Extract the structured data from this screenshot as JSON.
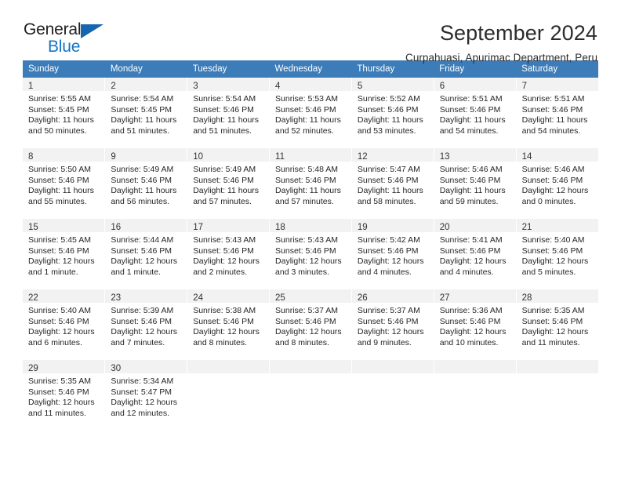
{
  "brand": {
    "name_top": "General",
    "name_bottom": "Blue",
    "triangle_color": "#1565b0",
    "blue_text_color": "#1275c4"
  },
  "header": {
    "title": "September 2024",
    "subtitle": "Curpahuasi, Apurimac Department, Peru"
  },
  "colors": {
    "header_row_bg": "#3c7cb8",
    "header_row_text": "#ffffff",
    "daynum_bg": "#f2f2f2",
    "cell_text": "#262626"
  },
  "weekday_headers": [
    "Sunday",
    "Monday",
    "Tuesday",
    "Wednesday",
    "Thursday",
    "Friday",
    "Saturday"
  ],
  "weeks": [
    [
      {
        "day": "1",
        "sunrise": "Sunrise: 5:55 AM",
        "sunset": "Sunset: 5:45 PM",
        "daylight1": "Daylight: 11 hours",
        "daylight2": "and 50 minutes."
      },
      {
        "day": "2",
        "sunrise": "Sunrise: 5:54 AM",
        "sunset": "Sunset: 5:45 PM",
        "daylight1": "Daylight: 11 hours",
        "daylight2": "and 51 minutes."
      },
      {
        "day": "3",
        "sunrise": "Sunrise: 5:54 AM",
        "sunset": "Sunset: 5:46 PM",
        "daylight1": "Daylight: 11 hours",
        "daylight2": "and 51 minutes."
      },
      {
        "day": "4",
        "sunrise": "Sunrise: 5:53 AM",
        "sunset": "Sunset: 5:46 PM",
        "daylight1": "Daylight: 11 hours",
        "daylight2": "and 52 minutes."
      },
      {
        "day": "5",
        "sunrise": "Sunrise: 5:52 AM",
        "sunset": "Sunset: 5:46 PM",
        "daylight1": "Daylight: 11 hours",
        "daylight2": "and 53 minutes."
      },
      {
        "day": "6",
        "sunrise": "Sunrise: 5:51 AM",
        "sunset": "Sunset: 5:46 PM",
        "daylight1": "Daylight: 11 hours",
        "daylight2": "and 54 minutes."
      },
      {
        "day": "7",
        "sunrise": "Sunrise: 5:51 AM",
        "sunset": "Sunset: 5:46 PM",
        "daylight1": "Daylight: 11 hours",
        "daylight2": "and 54 minutes."
      }
    ],
    [
      {
        "day": "8",
        "sunrise": "Sunrise: 5:50 AM",
        "sunset": "Sunset: 5:46 PM",
        "daylight1": "Daylight: 11 hours",
        "daylight2": "and 55 minutes."
      },
      {
        "day": "9",
        "sunrise": "Sunrise: 5:49 AM",
        "sunset": "Sunset: 5:46 PM",
        "daylight1": "Daylight: 11 hours",
        "daylight2": "and 56 minutes."
      },
      {
        "day": "10",
        "sunrise": "Sunrise: 5:49 AM",
        "sunset": "Sunset: 5:46 PM",
        "daylight1": "Daylight: 11 hours",
        "daylight2": "and 57 minutes."
      },
      {
        "day": "11",
        "sunrise": "Sunrise: 5:48 AM",
        "sunset": "Sunset: 5:46 PM",
        "daylight1": "Daylight: 11 hours",
        "daylight2": "and 57 minutes."
      },
      {
        "day": "12",
        "sunrise": "Sunrise: 5:47 AM",
        "sunset": "Sunset: 5:46 PM",
        "daylight1": "Daylight: 11 hours",
        "daylight2": "and 58 minutes."
      },
      {
        "day": "13",
        "sunrise": "Sunrise: 5:46 AM",
        "sunset": "Sunset: 5:46 PM",
        "daylight1": "Daylight: 11 hours",
        "daylight2": "and 59 minutes."
      },
      {
        "day": "14",
        "sunrise": "Sunrise: 5:46 AM",
        "sunset": "Sunset: 5:46 PM",
        "daylight1": "Daylight: 12 hours",
        "daylight2": "and 0 minutes."
      }
    ],
    [
      {
        "day": "15",
        "sunrise": "Sunrise: 5:45 AM",
        "sunset": "Sunset: 5:46 PM",
        "daylight1": "Daylight: 12 hours",
        "daylight2": "and 1 minute."
      },
      {
        "day": "16",
        "sunrise": "Sunrise: 5:44 AM",
        "sunset": "Sunset: 5:46 PM",
        "daylight1": "Daylight: 12 hours",
        "daylight2": "and 1 minute."
      },
      {
        "day": "17",
        "sunrise": "Sunrise: 5:43 AM",
        "sunset": "Sunset: 5:46 PM",
        "daylight1": "Daylight: 12 hours",
        "daylight2": "and 2 minutes."
      },
      {
        "day": "18",
        "sunrise": "Sunrise: 5:43 AM",
        "sunset": "Sunset: 5:46 PM",
        "daylight1": "Daylight: 12 hours",
        "daylight2": "and 3 minutes."
      },
      {
        "day": "19",
        "sunrise": "Sunrise: 5:42 AM",
        "sunset": "Sunset: 5:46 PM",
        "daylight1": "Daylight: 12 hours",
        "daylight2": "and 4 minutes."
      },
      {
        "day": "20",
        "sunrise": "Sunrise: 5:41 AM",
        "sunset": "Sunset: 5:46 PM",
        "daylight1": "Daylight: 12 hours",
        "daylight2": "and 4 minutes."
      },
      {
        "day": "21",
        "sunrise": "Sunrise: 5:40 AM",
        "sunset": "Sunset: 5:46 PM",
        "daylight1": "Daylight: 12 hours",
        "daylight2": "and 5 minutes."
      }
    ],
    [
      {
        "day": "22",
        "sunrise": "Sunrise: 5:40 AM",
        "sunset": "Sunset: 5:46 PM",
        "daylight1": "Daylight: 12 hours",
        "daylight2": "and 6 minutes."
      },
      {
        "day": "23",
        "sunrise": "Sunrise: 5:39 AM",
        "sunset": "Sunset: 5:46 PM",
        "daylight1": "Daylight: 12 hours",
        "daylight2": "and 7 minutes."
      },
      {
        "day": "24",
        "sunrise": "Sunrise: 5:38 AM",
        "sunset": "Sunset: 5:46 PM",
        "daylight1": "Daylight: 12 hours",
        "daylight2": "and 8 minutes."
      },
      {
        "day": "25",
        "sunrise": "Sunrise: 5:37 AM",
        "sunset": "Sunset: 5:46 PM",
        "daylight1": "Daylight: 12 hours",
        "daylight2": "and 8 minutes."
      },
      {
        "day": "26",
        "sunrise": "Sunrise: 5:37 AM",
        "sunset": "Sunset: 5:46 PM",
        "daylight1": "Daylight: 12 hours",
        "daylight2": "and 9 minutes."
      },
      {
        "day": "27",
        "sunrise": "Sunrise: 5:36 AM",
        "sunset": "Sunset: 5:46 PM",
        "daylight1": "Daylight: 12 hours",
        "daylight2": "and 10 minutes."
      },
      {
        "day": "28",
        "sunrise": "Sunrise: 5:35 AM",
        "sunset": "Sunset: 5:46 PM",
        "daylight1": "Daylight: 12 hours",
        "daylight2": "and 11 minutes."
      }
    ],
    [
      {
        "day": "29",
        "sunrise": "Sunrise: 5:35 AM",
        "sunset": "Sunset: 5:46 PM",
        "daylight1": "Daylight: 12 hours",
        "daylight2": "and 11 minutes."
      },
      {
        "day": "30",
        "sunrise": "Sunrise: 5:34 AM",
        "sunset": "Sunset: 5:47 PM",
        "daylight1": "Daylight: 12 hours",
        "daylight2": "and 12 minutes."
      },
      {
        "day": "",
        "sunrise": "",
        "sunset": "",
        "daylight1": "",
        "daylight2": ""
      },
      {
        "day": "",
        "sunrise": "",
        "sunset": "",
        "daylight1": "",
        "daylight2": ""
      },
      {
        "day": "",
        "sunrise": "",
        "sunset": "",
        "daylight1": "",
        "daylight2": ""
      },
      {
        "day": "",
        "sunrise": "",
        "sunset": "",
        "daylight1": "",
        "daylight2": ""
      },
      {
        "day": "",
        "sunrise": "",
        "sunset": "",
        "daylight1": "",
        "daylight2": ""
      }
    ]
  ]
}
